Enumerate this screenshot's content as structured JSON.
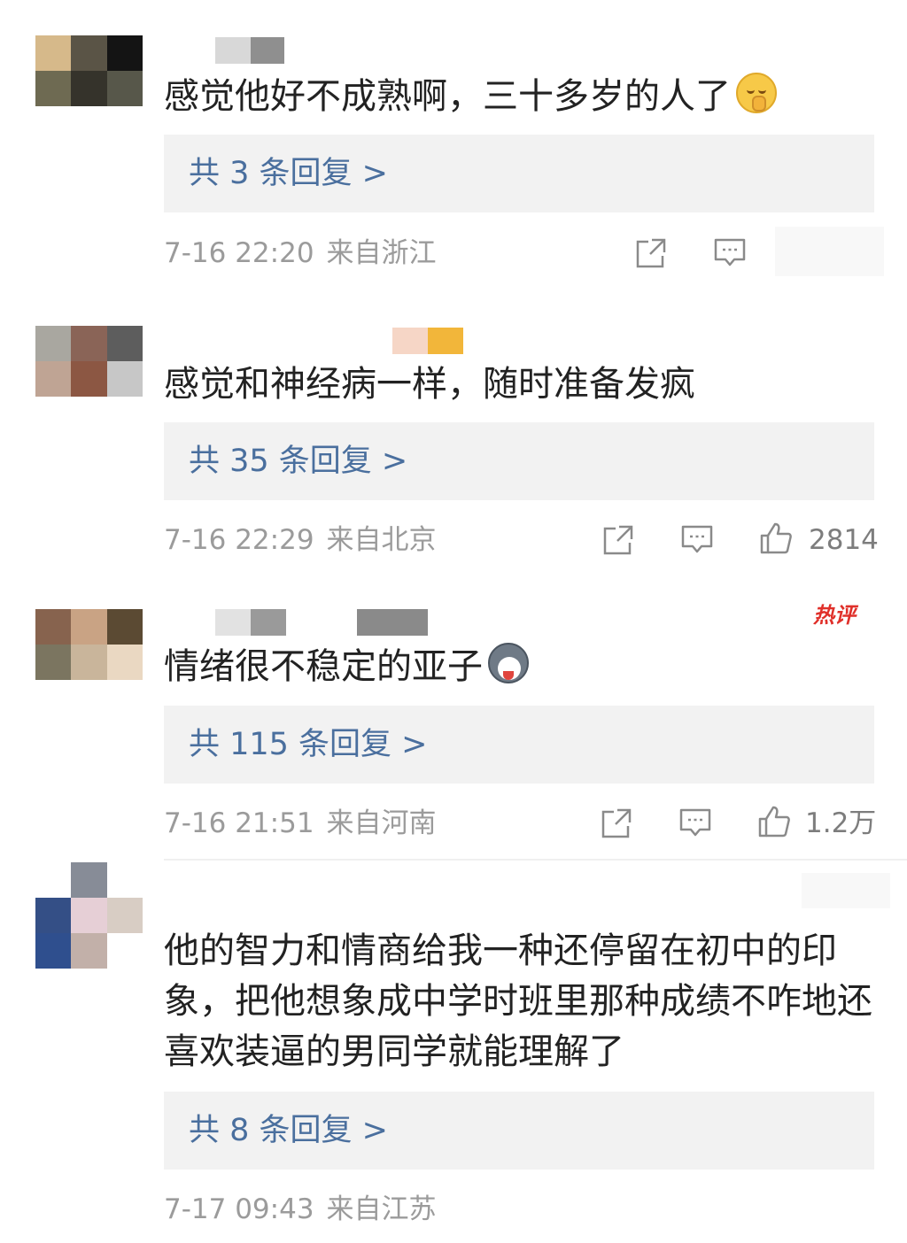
{
  "icons": {
    "share": "share-icon",
    "comment": "comment-icon",
    "like": "thumbs-up-icon"
  },
  "colors": {
    "reply_link": "#4a6f9e",
    "meta_text": "#9b9b9b",
    "hot_badge": "#e0302a",
    "reply_box_bg": "#f2f2f2"
  },
  "comments": [
    {
      "text": "感觉他好不成熟啊，三十多岁的人了",
      "emoji": "shushing-face-emoji",
      "replies_label": "共 3 条回复 >",
      "date": "7-16 22:20",
      "location": "来自浙江",
      "likes": ""
    },
    {
      "text": "感觉和神经病一样，随时准备发疯",
      "replies_label": "共 35 条回复 >",
      "date": "7-16 22:29",
      "location": "来自北京",
      "likes": "2814"
    },
    {
      "text": "情绪很不稳定的亚子",
      "emoji": "husky-dog-emoji",
      "badge": "热评",
      "replies_label": "共 115 条回复 >",
      "date": "7-16 21:51",
      "location": "来自河南",
      "likes": "1.2万"
    },
    {
      "text": "他的智力和情商给我一种还停留在初中的印象，把他想象成中学时班里那种成绩不咋地还喜欢装逼的男同学就能理解了",
      "replies_label": "共 8 条回复 >",
      "date": "7-17 09:43",
      "location": "来自江苏",
      "likes": ""
    }
  ]
}
